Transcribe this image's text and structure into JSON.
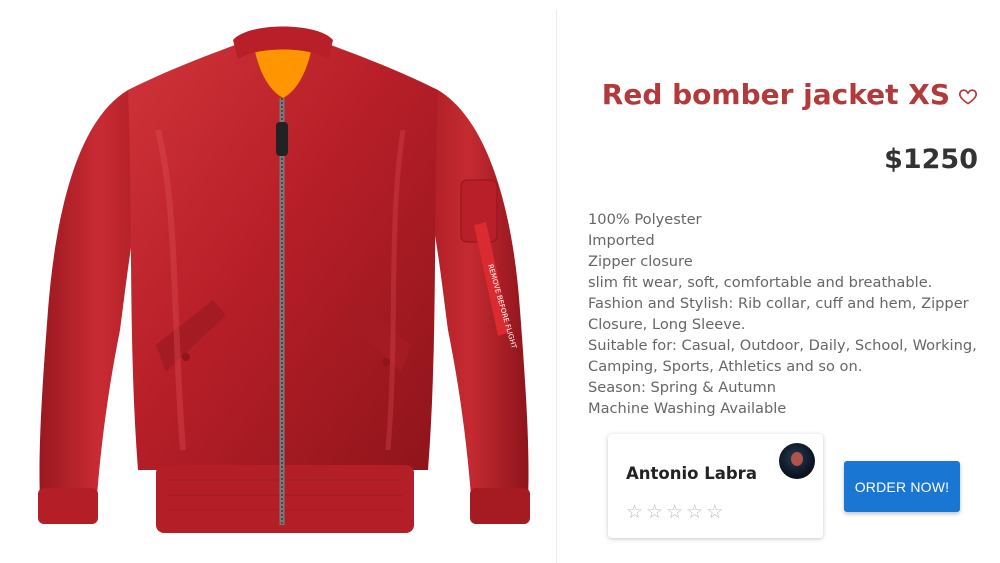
{
  "product": {
    "title": "Red bomber jacket XS",
    "price": "$1250",
    "image_icon": "red-bomber-jacket",
    "accent_color": "#b23a3a",
    "description": [
      "100% Polyester",
      "Imported",
      "Zipper closure",
      "slim fit wear, soft, comfortable and breathable.",
      "Fashion and Stylish: Rib collar, cuff and hem, Zipper Closure, Long Sleeve.",
      "Suitable for: Casual, Outdoor, Daily, School, Working, Camping, Sports, Athletics and so on.",
      "Season: Spring & Autumn",
      "Machine Washing Available"
    ]
  },
  "review": {
    "name": "Antonio Labra",
    "rating": 0,
    "max_rating": 5,
    "star_glyph": "☆"
  },
  "actions": {
    "order_label": "ORDER NOW!",
    "button_color": "#1976d2",
    "favorite_icon": "heart-outline-icon"
  }
}
